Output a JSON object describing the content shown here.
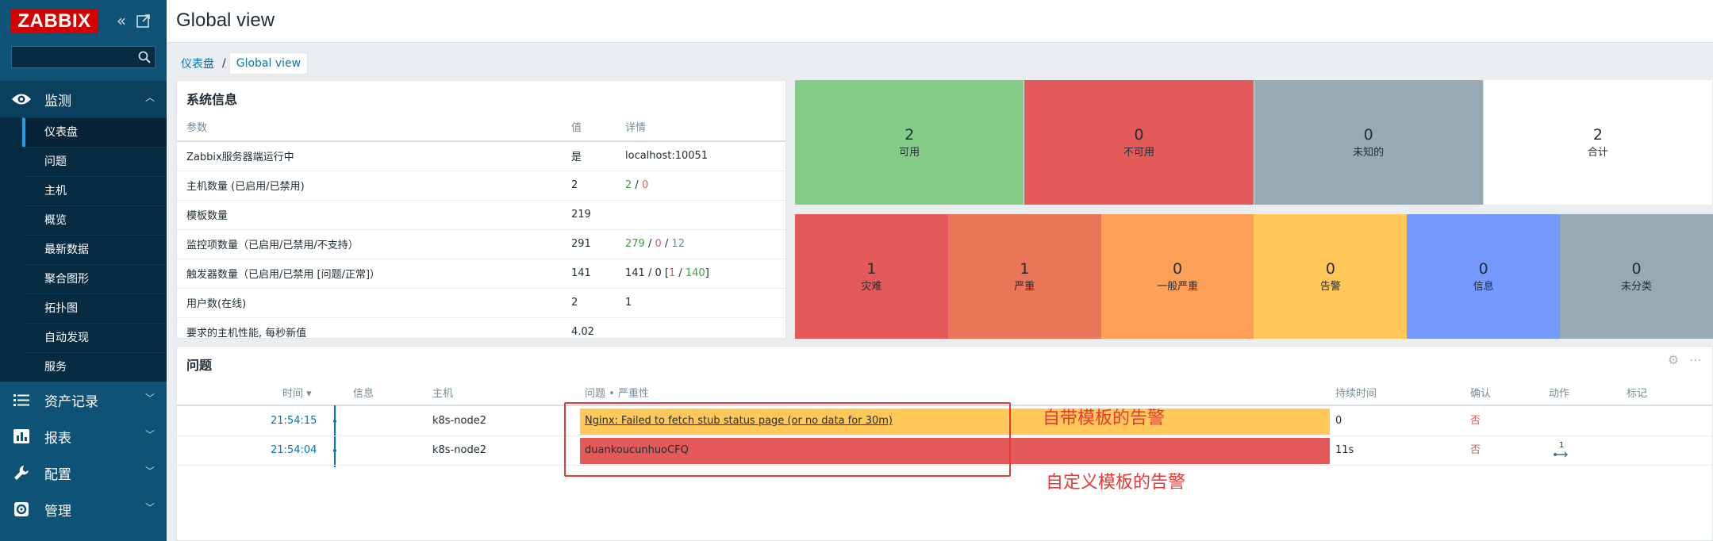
{
  "brand": {
    "logo_text": "ZABBIX",
    "logo_color": "#d40000",
    "sidebar_color": "#0e5275"
  },
  "sidebar": {
    "search_placeholder": "",
    "sections": [
      {
        "label": "监测",
        "icon": "eye-icon",
        "expanded": true
      },
      {
        "label": "资产记录",
        "icon": "list-icon"
      },
      {
        "label": "报表",
        "icon": "bar-chart-icon"
      },
      {
        "label": "配置",
        "icon": "wrench-icon"
      },
      {
        "label": "管理",
        "icon": "gear-icon"
      }
    ],
    "monitoring_items": [
      "仪表盘",
      "问题",
      "主机",
      "概览",
      "最新数据",
      "聚合图形",
      "拓扑图",
      "自动发现",
      "服务"
    ],
    "active_item": "仪表盘"
  },
  "header": {
    "title": "Global view"
  },
  "breadcrumb": {
    "parent": "仪表盘",
    "separator": "/",
    "current": "Global view"
  },
  "system_info": {
    "title": "系统信息",
    "columns": [
      "参数",
      "值",
      "详情"
    ],
    "rows": [
      {
        "param": "Zabbix服务器端运行中",
        "value": "是",
        "details": "localhost:10051"
      },
      {
        "param": "主机数量 (已启用/已禁用)",
        "value": "2",
        "d1": "2",
        "s1": " / ",
        "d2": "0"
      },
      {
        "param": "模板数量",
        "value": "219",
        "details": ""
      },
      {
        "param": "监控项数量（已启用/已禁用/不支持）",
        "value": "291",
        "d1": "279",
        "s1": " / ",
        "d2": "0",
        "s2": " / ",
        "d3": "12"
      },
      {
        "param": "触发器数量（已启用/已禁用 [问题/正常]）",
        "value": "141",
        "d1": "141 / 0 [",
        "d2": "1",
        "s2": " / ",
        "d3": "140",
        "s3": "]"
      },
      {
        "param": "用户数(在线)",
        "value": "2",
        "details": "1"
      },
      {
        "param": "要求的主机性能, 每秒新值",
        "value": "4.02",
        "details": ""
      }
    ]
  },
  "host_availability": [
    {
      "count": "2",
      "label": "可用",
      "color": "#86cc89"
    },
    {
      "count": "0",
      "label": "不可用",
      "color": "#e45959"
    },
    {
      "count": "0",
      "label": "未知的",
      "color": "#97aab3"
    },
    {
      "count": "2",
      "label": "合计",
      "color": "#ffffff"
    }
  ],
  "problems_by_severity": [
    {
      "count": "1",
      "label": "灾难",
      "color": "#e45959"
    },
    {
      "count": "1",
      "label": "严重",
      "color": "#e97659"
    },
    {
      "count": "0",
      "label": "一般严重",
      "color": "#ffa059"
    },
    {
      "count": "0",
      "label": "告警",
      "color": "#ffc859"
    },
    {
      "count": "0",
      "label": "信息",
      "color": "#7499ff"
    },
    {
      "count": "0",
      "label": "未分类",
      "color": "#97aab3"
    }
  ],
  "problems": {
    "title": "问题",
    "columns": {
      "time": "时间 ▾",
      "info": "信息",
      "host": "主机",
      "problem": "问题 • 严重性",
      "duration": "持续时间",
      "ack": "确认",
      "actions": "动作",
      "tags": "标记"
    },
    "rows": [
      {
        "time": "21:54:15",
        "host": "k8s-node2",
        "problem": "Nginx: Failed to fetch stub status page (or no data for 30m)",
        "duration": "0",
        "ack": "否",
        "color": "#ffc859",
        "actions": ""
      },
      {
        "time": "21:54:04",
        "host": "k8s-node2",
        "problem": "duankoucunhuoCFQ",
        "duration": "11s",
        "ack": "否",
        "color": "#e45959",
        "actions": "1"
      }
    ]
  },
  "annotations": {
    "label_1": "自带模板的告警",
    "label_2": "自定义模板的告警",
    "color": "#e53935"
  }
}
